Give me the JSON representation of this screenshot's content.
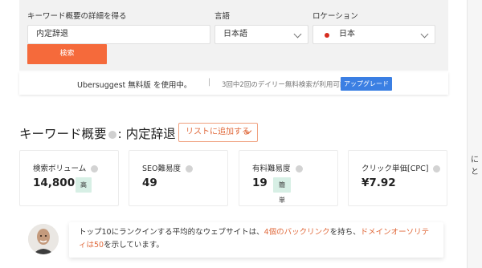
{
  "form": {
    "keyword_label": "キーワード概要の詳細を得る",
    "keyword_value": "内定辞退",
    "language_label": "言語",
    "language_value": "日本語",
    "location_label": "ロケーション",
    "location_value": "日本",
    "search_button": "検索"
  },
  "notice": {
    "main": "Ubersuggest 無料版 を使用中。",
    "separator": "|",
    "daily_limit": "3回中2回のデイリー無料検索が利用可能",
    "upgrade_button": "アップグレード"
  },
  "overview": {
    "title_prefix": "キーワード概要",
    "title_keyword": ": 内定辞退",
    "add_to_list": "リストに追加する"
  },
  "metrics": [
    {
      "label": "検索ボリューム",
      "value": "14,800",
      "badge": "高"
    },
    {
      "label": "SEO難易度",
      "value": "49",
      "badge": ""
    },
    {
      "label": "有料難易度",
      "value": "19",
      "badge": "簡単"
    },
    {
      "label": "クリック単価[CPC]",
      "value": "¥7.92",
      "badge": ""
    }
  ],
  "tip": {
    "part1": "トップ10にランクインする平均的なウェブサイトは、",
    "hl1": "4個のバックリンク",
    "part2": "を持ち、",
    "hl2": "ドメインオーソリティは50",
    "part3": "を示しています。"
  },
  "side_text": "にと",
  "colors": {
    "accent": "#f56a3b",
    "upgrade": "#3b7fe3",
    "badge_bg": "#d7efe5",
    "panel_bg": "#f2f2f2"
  }
}
